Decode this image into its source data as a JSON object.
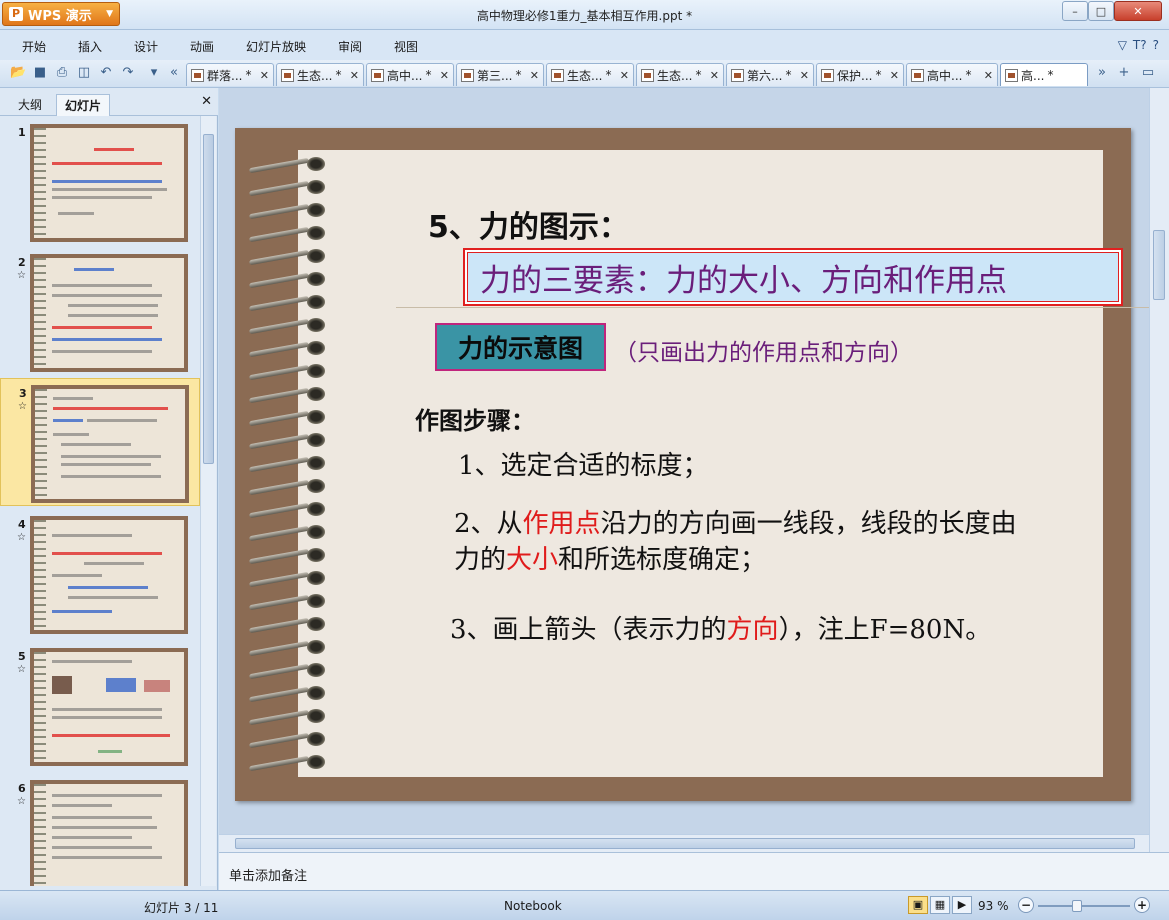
{
  "app": {
    "button_label": "WPS 演示",
    "title": "高中物理必修1重力_基本相互作用.ppt *"
  },
  "window_controls": {
    "minimize": "–",
    "maximize": "□",
    "close": "✕"
  },
  "menu": [
    "开始",
    "插入",
    "设计",
    "动画",
    "幻灯片放映",
    "审阅",
    "视图"
  ],
  "menu_right": [
    "▽",
    "T?",
    "?"
  ],
  "doc_tabs": [
    {
      "label": "群落...",
      "active": false
    },
    {
      "label": "生态...",
      "active": false
    },
    {
      "label": "高中...",
      "active": false
    },
    {
      "label": "第三...",
      "active": false
    },
    {
      "label": "生态...",
      "active": false
    },
    {
      "label": "生态...",
      "active": false
    },
    {
      "label": "第六...",
      "active": false
    },
    {
      "label": "保护...",
      "active": false
    },
    {
      "label": "高中...",
      "active": false
    },
    {
      "label": "高...",
      "active": true
    }
  ],
  "panel": {
    "tabs": [
      "大纲",
      "幻灯片"
    ],
    "close": "✕"
  },
  "thumbnails": [
    {
      "num": "1",
      "star": ""
    },
    {
      "num": "2",
      "star": "☆"
    },
    {
      "num": "3",
      "star": "☆",
      "selected": true
    },
    {
      "num": "4",
      "star": "☆"
    },
    {
      "num": "5",
      "star": "☆"
    },
    {
      "num": "6",
      "star": "☆"
    }
  ],
  "slide": {
    "heading": "5、力的图示：",
    "three_elements": "力的三要素：力的大小、方向和作用点",
    "diagram_label": "力的示意图",
    "diagram_note": "（只画出力的作用点和方向）",
    "steps_title": "作图步骤：",
    "step1": "1、选定合适的标度；",
    "step2_a": "2、从",
    "step2_red1": "作用点",
    "step2_b": "沿力的方向画一线段，线段的长度由",
    "step2_c": "力的",
    "step2_red2": "大小",
    "step2_d": "和所选标度确定；",
    "step3_a": "3、画上箭头（表示力的",
    "step3_red": "方向",
    "step3_b": "），注上F=80N。"
  },
  "notes": {
    "placeholder": "单击添加备注"
  },
  "status": {
    "slide_counter": "幻灯片 3 / 11",
    "theme": "Notebook",
    "zoom": "93 %"
  }
}
